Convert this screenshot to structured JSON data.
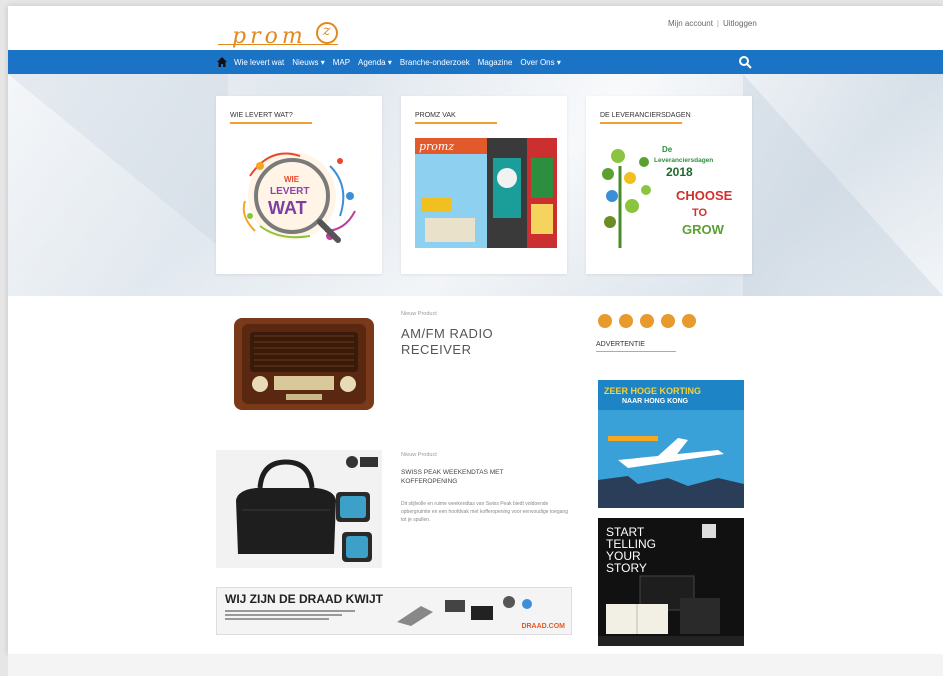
{
  "header": {
    "logo_text": "prom",
    "logo_letter": "z",
    "account_link": "Mijn account",
    "logout_link": "Uitloggen"
  },
  "nav": {
    "items": [
      {
        "label": "Wie levert wat"
      },
      {
        "label": "Nieuws ▾"
      },
      {
        "label": "MAP"
      },
      {
        "label": "Agenda ▾"
      },
      {
        "label": "Branche-onderzoek"
      },
      {
        "label": "Magazine"
      },
      {
        "label": "Over Ons ▾"
      }
    ]
  },
  "hero": {
    "cards": [
      {
        "title": "Wie levert wat?",
        "image_text_top": "WIE",
        "image_text_mid": "LEVERT",
        "image_text_bottom": "WAT"
      },
      {
        "title": "Promz Vak",
        "image_text": "promz"
      },
      {
        "title": "De Leveranciersdagen",
        "image_line1": "De",
        "image_line2": "Leveranciersdagen",
        "image_line3": "2018",
        "image_line4": "CHOOSE",
        "image_line5": "TO",
        "image_line6": "GROW"
      }
    ]
  },
  "products": [
    {
      "label": "Nieuw Product",
      "title_line1": "AM/FM RADIO",
      "title_line2": "RECEIVER"
    },
    {
      "label": "Nieuw Product",
      "title_line1": "SWISS PEAK WEEKENDTAS MET",
      "title_line2": "KOFFEROPENING",
      "desc": "Dit stijlvolle en ruime weekendtas van Swiss Peak biedt voldoende opbergruimte en een hoofdvak met kofferopening voor eenvoudige toegang tot je spullen."
    }
  ],
  "banner": {
    "text": "WIJ ZIJN DE DRAAD KWIJT",
    "brand": "DRAAD.COM"
  },
  "sidebar": {
    "advertentie_label": "Advertentie",
    "ad1": {
      "line1": "ZEER HOGE KORTING",
      "line2": "NAAR HONG KONG"
    },
    "ad2": {
      "line1": "START",
      "line2": "TELLING",
      "line3": "YOUR",
      "line4": "STORY"
    }
  },
  "colors": {
    "nav_blue": "#1b73c6",
    "accent_orange": "#f0a030"
  }
}
